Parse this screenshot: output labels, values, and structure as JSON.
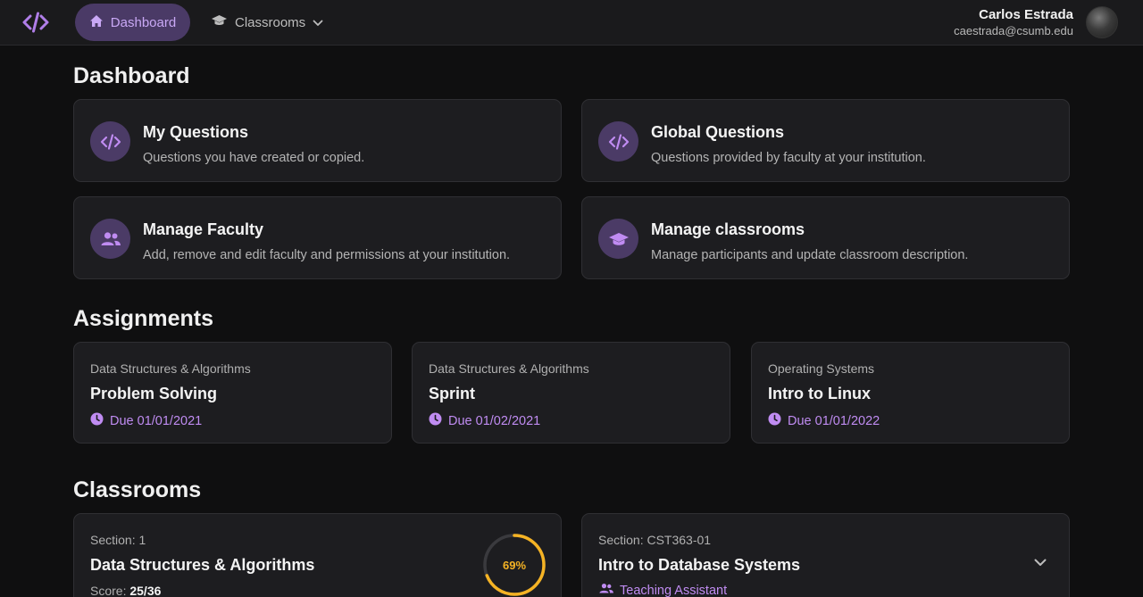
{
  "nav": {
    "dashboard_label": "Dashboard",
    "classrooms_label": "Classrooms",
    "logo_icon": "code-icon",
    "dashboard_icon": "home-icon",
    "classrooms_icon": "graduation-cap-icon",
    "chevron_icon": "chevron-down-icon"
  },
  "user": {
    "name": "Carlos Estrada",
    "email": "caestrada@csumb.edu"
  },
  "dashboard": {
    "title": "Dashboard",
    "cards": [
      {
        "title": "My Questions",
        "desc": "Questions you have created or copied.",
        "icon": "code-icon"
      },
      {
        "title": "Global Questions",
        "desc": "Questions provided by faculty at your institution.",
        "icon": "code-icon"
      },
      {
        "title": "Manage Faculty",
        "desc": "Add, remove and edit faculty and permissions at your institution.",
        "icon": "users-icon"
      },
      {
        "title": "Manage classrooms",
        "desc": "Manage participants and update classroom description.",
        "icon": "graduation-cap-icon"
      }
    ]
  },
  "assignments": {
    "title": "Assignments",
    "items": [
      {
        "course": "Data Structures & Algorithms",
        "title": "Problem Solving",
        "due": "Due 01/01/2021"
      },
      {
        "course": "Data Structures & Algorithms",
        "title": "Sprint",
        "due": "Due 01/02/2021"
      },
      {
        "course": "Operating Systems",
        "title": "Intro to Linux",
        "due": "Due 01/01/2022"
      }
    ]
  },
  "classrooms": {
    "title": "Classrooms",
    "items": [
      {
        "section": "Section: 1",
        "title": "Data Structures & Algorithms",
        "score_label": "Score:",
        "score_value": "25/36",
        "progress_text": "69%",
        "progress": 0.69
      },
      {
        "section": "Section: CST363-01",
        "title": "Intro to Database Systems",
        "role": "Teaching Assistant"
      }
    ]
  },
  "colors": {
    "accent": "#c08cf2",
    "accent_bg": "#4b3b66",
    "progress": "#f5b324",
    "card_bg": "#1d1d20",
    "page_bg": "#0f0f10"
  }
}
